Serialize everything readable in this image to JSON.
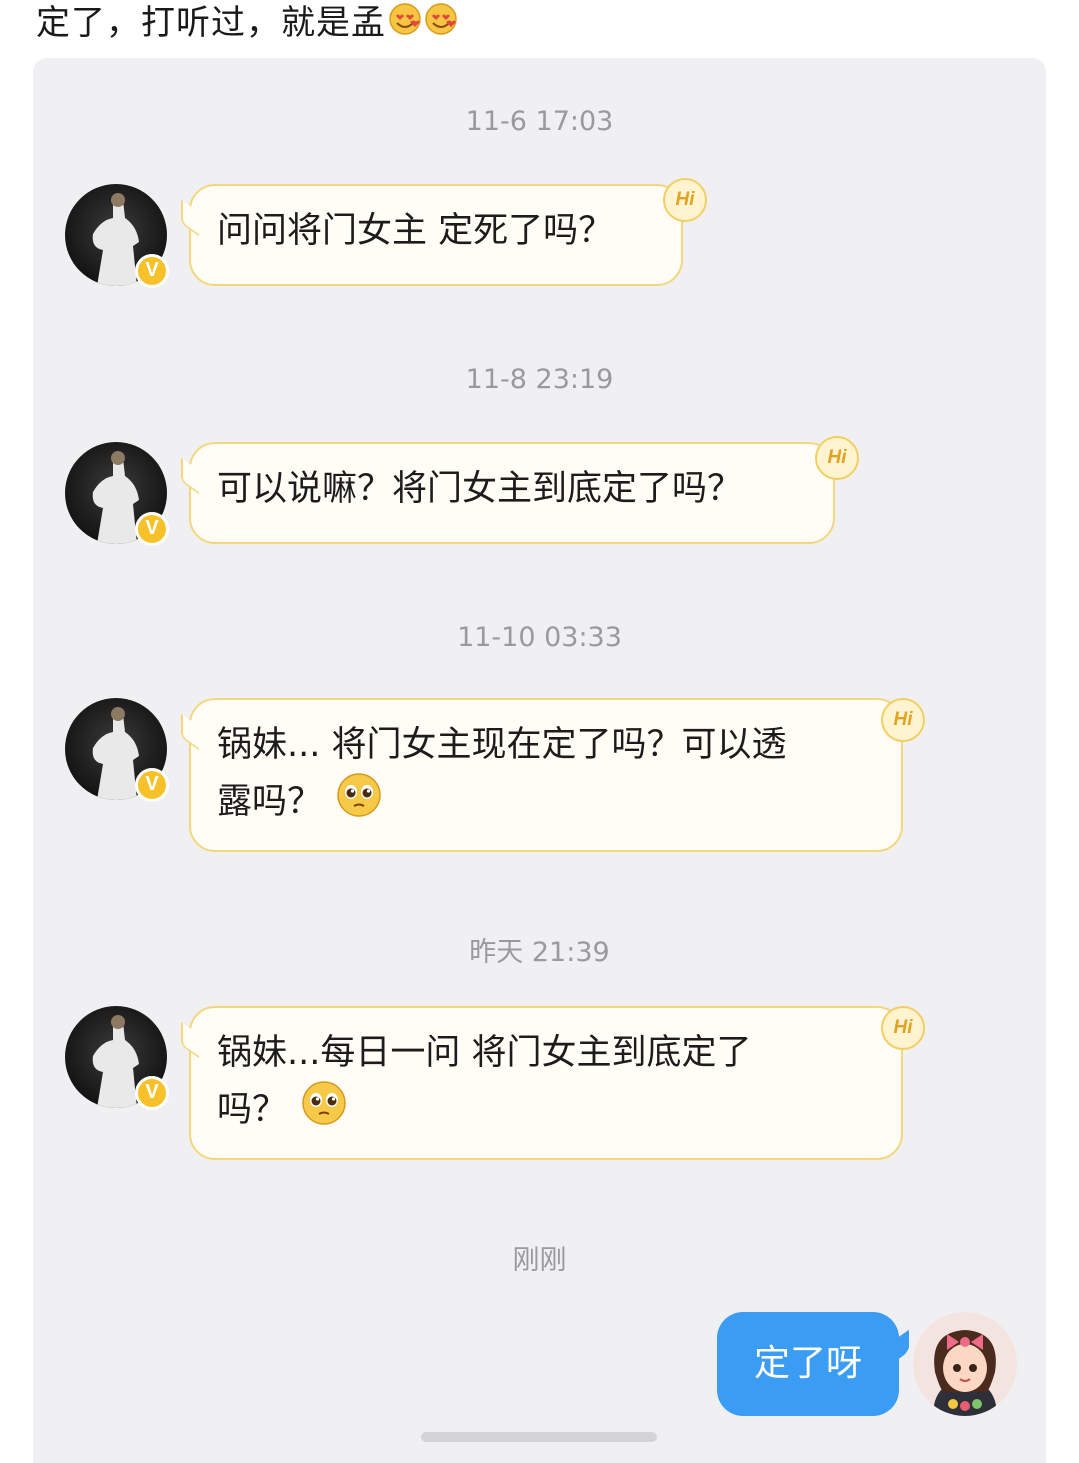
{
  "caption": "定了，打听过，就是孟",
  "messages": [
    {
      "time": "11-6 17:03",
      "lines": [
        "问问将门女主 定死了吗？"
      ],
      "emoji": null
    },
    {
      "time": "11-8 23:19",
      "lines": [
        "可以说嘛？将门女主到底定了吗？"
      ],
      "emoji": null
    },
    {
      "time": "11-10 03:33",
      "lines": [
        "锅妹... 将门女主现在定了吗？可以透",
        "露吗？"
      ],
      "emoji": "pleading-face"
    },
    {
      "time": "昨天 21:39",
      "lines": [
        "锅妹...每日一问 将门女主到底定了",
        "吗？"
      ],
      "emoji": "pleading-face"
    }
  ],
  "hi_label": "Hi",
  "verified_label": "V",
  "reply": {
    "time": "刚刚",
    "text": "定了呀"
  },
  "colors": {
    "bubble_border": "#f3d77e",
    "sent_bubble": "#3a9cf2",
    "badge": "#f7c12a"
  }
}
